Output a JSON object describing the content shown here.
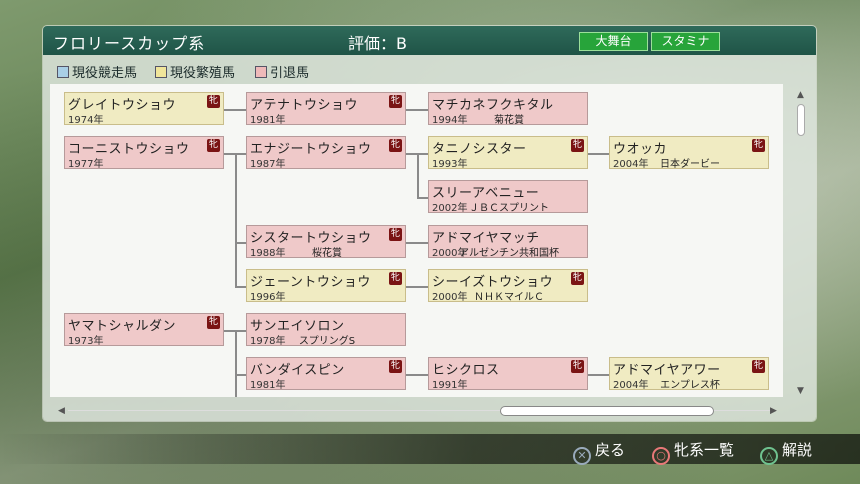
{
  "header": {
    "title": "フロリースカップ系",
    "rating": "評価：B",
    "tags": [
      "大舞台",
      "スタミナ"
    ]
  },
  "legend": [
    {
      "label": "現役競走馬",
      "color": "#a9cfe6"
    },
    {
      "label": "現役繁殖馬",
      "color": "#f0e59a"
    },
    {
      "label": "引退馬",
      "color": "#efb9b9"
    }
  ],
  "horses": [
    {
      "name": "グレイトウショウ",
      "year": "1974年",
      "title": "",
      "mark": "牝",
      "status": "active"
    },
    {
      "name": "コーニストウショウ",
      "year": "1977年",
      "title": "",
      "mark": "牝",
      "status": "retired"
    },
    {
      "name": "ヤマトシャルダン",
      "year": "1973年",
      "title": "",
      "mark": "牝",
      "status": "retired"
    },
    {
      "name": "アテナトウショウ",
      "year": "1981年",
      "title": "",
      "mark": "牝",
      "status": "retired"
    },
    {
      "name": "エナジートウショウ",
      "year": "1987年",
      "title": "",
      "mark": "牝",
      "status": "retired"
    },
    {
      "name": "シスタートウショウ",
      "year": "1988年",
      "title": "桜花賞",
      "mark": "牝",
      "status": "retired"
    },
    {
      "name": "ジェーントウショウ",
      "year": "1996年",
      "title": "",
      "mark": "牝",
      "status": "active"
    },
    {
      "name": "サンエイソロン",
      "year": "1978年",
      "title": "スプリングS",
      "mark": "",
      "status": "retired"
    },
    {
      "name": "バンダイスピン",
      "year": "1981年",
      "title": "",
      "mark": "牝",
      "status": "retired"
    },
    {
      "name": "マチカネフクキタル",
      "year": "1994年",
      "title": "菊花賞",
      "mark": "",
      "status": "retired"
    },
    {
      "name": "タニノシスター",
      "year": "1993年",
      "title": "",
      "mark": "牝",
      "status": "active"
    },
    {
      "name": "スリーアベニュー",
      "year": "2002年",
      "title": "ＪＢＣスプリント",
      "mark": "",
      "status": "retired"
    },
    {
      "name": "アドマイヤマッチ",
      "year": "2000年",
      "title": "アルゼンチン共和国杯",
      "mark": "",
      "status": "retired"
    },
    {
      "name": "シーイズトウショウ",
      "year": "2000年",
      "title": "ＮＨＫマイルＣ",
      "mark": "牝",
      "status": "active"
    },
    {
      "name": "ヒシクロス",
      "year": "1991年",
      "title": "",
      "mark": "牝",
      "status": "retired"
    },
    {
      "name": "ウオッカ",
      "year": "2004年",
      "title": "日本ダービー",
      "mark": "牝",
      "status": "active"
    },
    {
      "name": "アドマイヤアワー",
      "year": "2004年",
      "title": "エンプレス杯",
      "mark": "牝",
      "status": "active"
    }
  ],
  "footer": {
    "back": {
      "icon": "✕",
      "label": "戻る"
    },
    "list": {
      "icon": "○",
      "label": "牝系一覧"
    },
    "help": {
      "icon": "△",
      "label": "解説"
    }
  }
}
